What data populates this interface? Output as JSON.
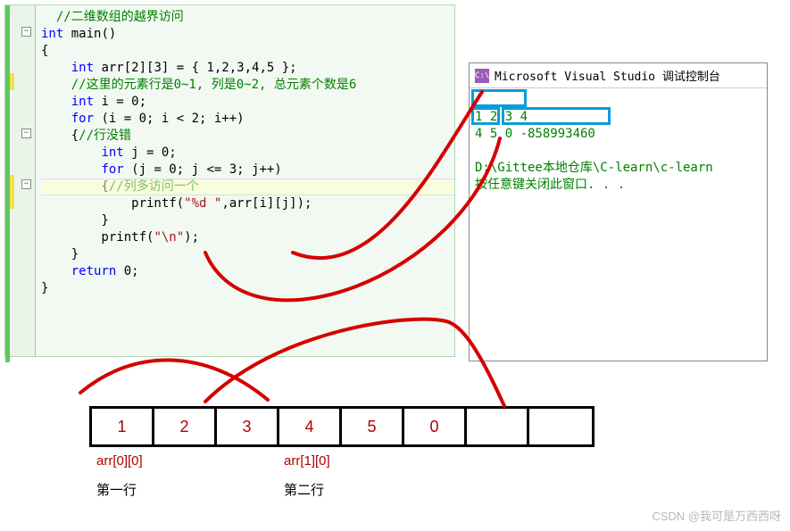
{
  "code": {
    "lines": [
      {
        "html": "  <span class='c'>//二维数组的越界访问</span>"
      },
      {
        "html": "<span class='k'>int</span> main()"
      },
      {
        "html": "{"
      },
      {
        "html": "    <span class='k'>int</span> arr[2][3] = { 1,2,3,4,5 };"
      },
      {
        "html": "    <span class='c'>//这里的元素行是0~1, 列是0~2, 总元素个数是6</span>"
      },
      {
        "html": "    <span class='k'>int</span> i = 0;"
      },
      {
        "html": "    <span class='k'>for</span> (i = 0; i &lt; 2; i++)"
      },
      {
        "html": "    {<span class='c'>//行没错</span>"
      },
      {
        "html": "        <span class='k'>int</span> j = 0;"
      },
      {
        "html": "        <span class='k'>for</span> (j = 0; j &lt;= 3; j++)"
      },
      {
        "html": "        {<span class='c'>//列多访问一个</span>"
      },
      {
        "html": "            printf(<span class='s'>\"%d \"</span>,arr[i][j]);"
      },
      {
        "html": "        }"
      },
      {
        "html": "        printf(<span class='s'>\"\\n\"</span>);"
      },
      {
        "html": "    }"
      },
      {
        "html": "    <span class='k'>return</span> 0;"
      },
      {
        "html": "}"
      }
    ]
  },
  "console": {
    "title": "Microsoft Visual Studio 调试控制台",
    "out1": "1 2 3 4",
    "out2": "4 5 0 -858993460",
    "blank": "",
    "path": "D:\\Gittee本地仓库\\C-learn\\c-learn",
    "msg": "按任意键关闭此窗口. . ."
  },
  "diagram": {
    "cells": [
      "1",
      "2",
      "3",
      "4",
      "5",
      "0",
      "",
      ""
    ],
    "label1": "arr[0][0]",
    "label2": "arr[1][0]",
    "row1": "第一行",
    "row2": "第二行"
  },
  "watermark": "CSDN @我可是万西西呀"
}
